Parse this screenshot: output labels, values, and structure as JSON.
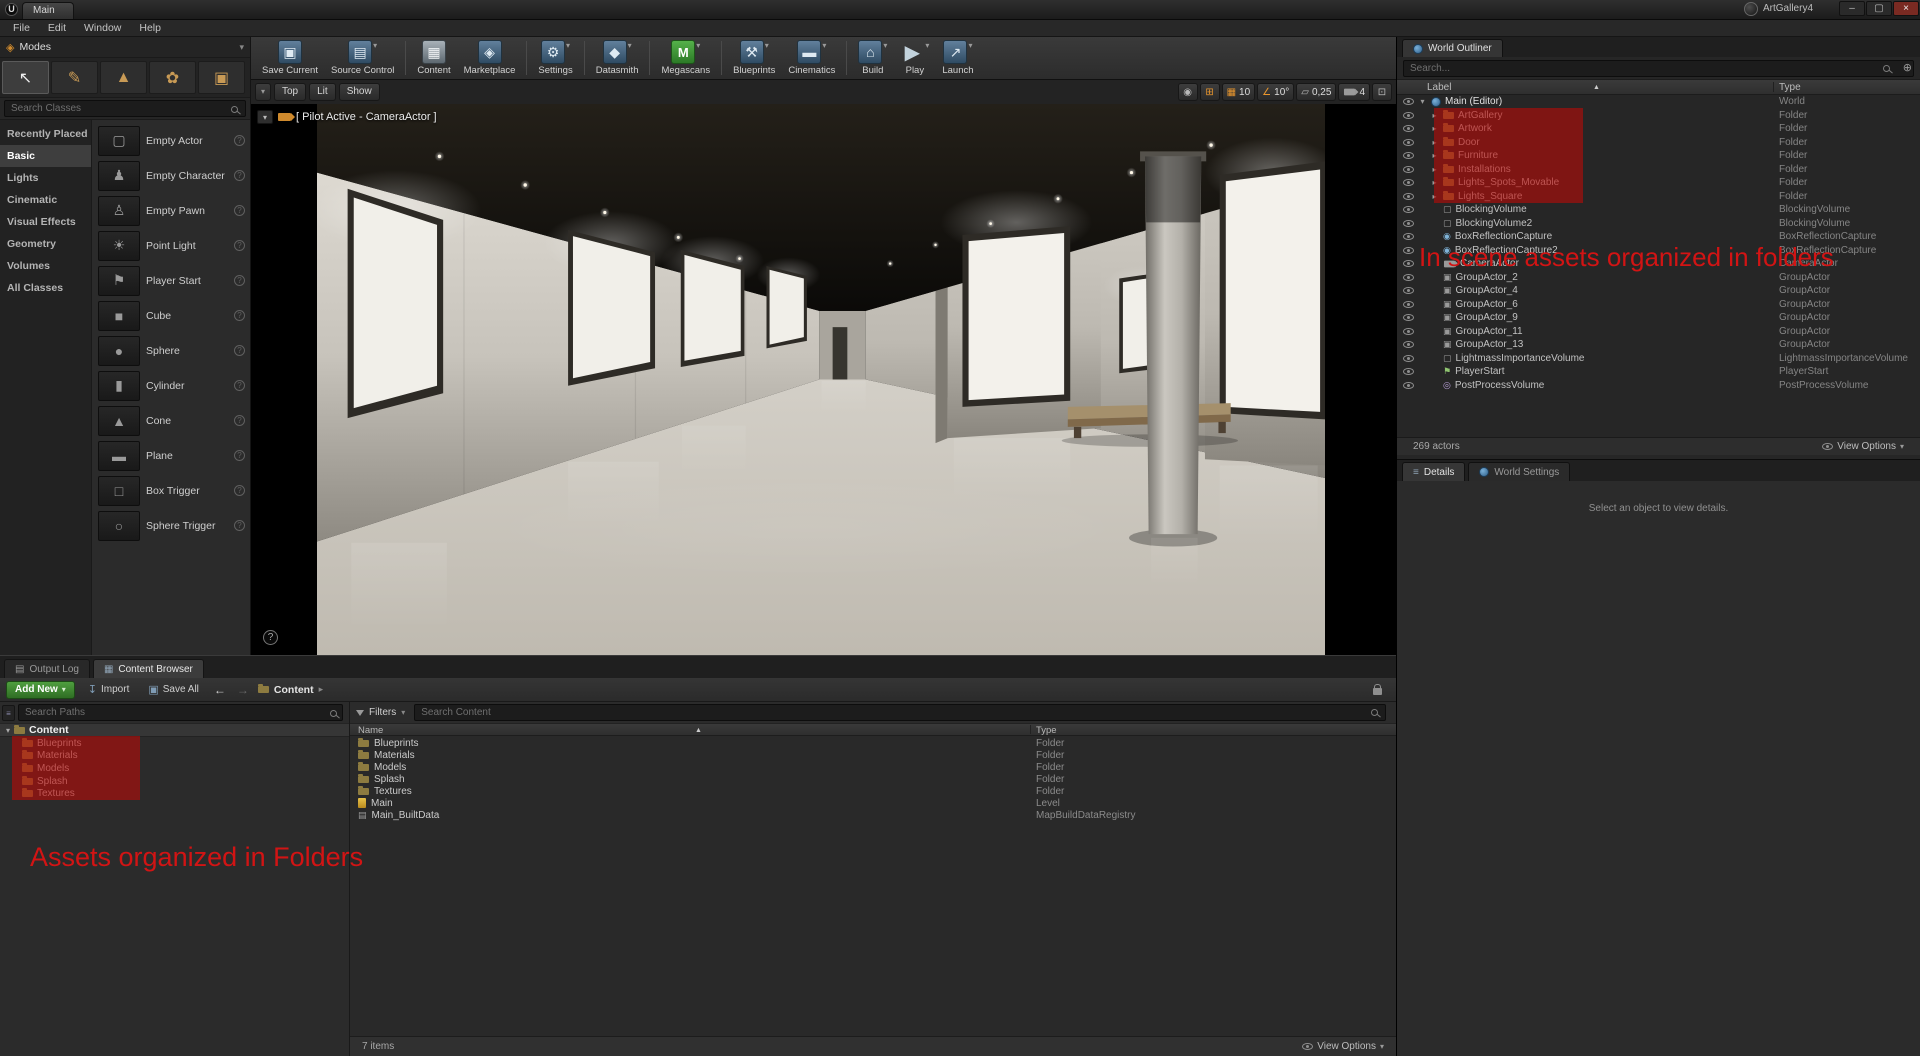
{
  "titlebar": {
    "logo": "U",
    "tab": "Main",
    "project": "ArtGallery4",
    "minimize": "–",
    "maximize": "▢",
    "close": "×"
  },
  "menubar": {
    "items": [
      "File",
      "Edit",
      "Window",
      "Help"
    ]
  },
  "icons": {
    "chevron_down": "▾",
    "chevron_right": "▸",
    "sort_asc": "▲",
    "back_arrow": "←",
    "forward_arrow": "→",
    "controller": "◉",
    "surface_snap": "⊞",
    "grid": "▦",
    "angle": "∠",
    "scale": "▱",
    "maximize": "⊡",
    "plus": "⊕",
    "hamburger": "≡",
    "volume": "▢",
    "capture": "◉",
    "group": "▣",
    "playerstart": "⚑",
    "ppvolume": "◎",
    "data": "▤",
    "output_log": "▤",
    "content_drawer": "▦",
    "import": "↧",
    "save": "▣",
    "details": "≡"
  },
  "modes_panel": {
    "title": "Modes",
    "tools": [
      {
        "name": "place-mode",
        "glyph": "↖",
        "active": true
      },
      {
        "name": "paint-mode",
        "glyph": "✎",
        "active": false
      },
      {
        "name": "landscape-mode",
        "glyph": "▲",
        "active": false
      },
      {
        "name": "foliage-mode",
        "glyph": "✿",
        "active": false
      },
      {
        "name": "geometry-mode",
        "glyph": "▣",
        "active": false
      }
    ],
    "search_placeholder": "Search Classes",
    "categories": [
      {
        "label": "Recently Placed",
        "selected": false
      },
      {
        "label": "Basic",
        "selected": true
      },
      {
        "label": "Lights",
        "selected": false
      },
      {
        "label": "Cinematic",
        "selected": false
      },
      {
        "label": "Visual Effects",
        "selected": false
      },
      {
        "label": "Geometry",
        "selected": false
      },
      {
        "label": "Volumes",
        "selected": false
      },
      {
        "label": "All Classes",
        "selected": false
      }
    ],
    "items": [
      {
        "label": "Empty Actor",
        "glyph": "▢"
      },
      {
        "label": "Empty Character",
        "glyph": "♟"
      },
      {
        "label": "Empty Pawn",
        "glyph": "♙"
      },
      {
        "label": "Point Light",
        "glyph": "☀"
      },
      {
        "label": "Player Start",
        "glyph": "⚑"
      },
      {
        "label": "Cube",
        "glyph": "■"
      },
      {
        "label": "Sphere",
        "glyph": "●"
      },
      {
        "label": "Cylinder",
        "glyph": "▮"
      },
      {
        "label": "Cone",
        "glyph": "▲"
      },
      {
        "label": "Plane",
        "glyph": "▬"
      },
      {
        "label": "Box Trigger",
        "glyph": "□"
      },
      {
        "label": "Sphere Trigger",
        "glyph": "○"
      }
    ]
  },
  "main_toolbar": {
    "buttons": [
      {
        "label": "Save Current",
        "glyph": "▣",
        "style": "blue",
        "dropdown": false
      },
      {
        "label": "Source Control",
        "glyph": "▤",
        "style": "blue",
        "dropdown": true
      },
      {
        "separator": true
      },
      {
        "label": "Content",
        "glyph": "▦",
        "style": "steel",
        "dropdown": false
      },
      {
        "label": "Marketplace",
        "glyph": "◈",
        "style": "blue",
        "dropdown": false
      },
      {
        "separator": true
      },
      {
        "label": "Settings",
        "glyph": "⚙",
        "style": "blue",
        "dropdown": true
      },
      {
        "separator": true
      },
      {
        "label": "Datasmith",
        "glyph": "◆",
        "style": "blue",
        "dropdown": true
      },
      {
        "separator": true
      },
      {
        "label": "Megascans",
        "glyph": "M",
        "style": "green",
        "dropdown": true
      },
      {
        "separator": true
      },
      {
        "label": "Blueprints",
        "glyph": "⚒",
        "style": "blue",
        "dropdown": true
      },
      {
        "label": "Cinematics",
        "glyph": "▬",
        "style": "blue",
        "dropdown": true
      },
      {
        "separator": true
      },
      {
        "label": "Build",
        "glyph": "⌂",
        "style": "blue",
        "dropdown": true
      },
      {
        "label": "Play",
        "glyph": "▶",
        "style": "play",
        "dropdown": true
      },
      {
        "label": "Launch",
        "glyph": "↗",
        "style": "blue",
        "dropdown": true
      }
    ]
  },
  "viewport": {
    "pilot_label": "[ Pilot Active - CameraActor ]",
    "view_buttons": [
      "Top",
      "Lit",
      "Show"
    ],
    "snap": {
      "grid": "10",
      "angle": "10°",
      "scale": "0,25",
      "camera_speed": "4"
    },
    "help": "?"
  },
  "outliner": {
    "tab": "World Outliner",
    "search_placeholder": "Search...",
    "col_label": "Label",
    "col_type": "Type",
    "rows": [
      {
        "label": "Main (Editor)",
        "type": "World",
        "depth": 0,
        "icon": "world",
        "exp": "open"
      },
      {
        "label": "ArtGallery",
        "type": "Folder",
        "depth": 1,
        "icon": "folder",
        "exp": "closed",
        "hl": true
      },
      {
        "label": "Artwork",
        "type": "Folder",
        "depth": 1,
        "icon": "folder",
        "exp": "closed",
        "hl": true
      },
      {
        "label": "Door",
        "type": "Folder",
        "depth": 1,
        "icon": "folder",
        "exp": "closed",
        "hl": true
      },
      {
        "label": "Furniture",
        "type": "Folder",
        "depth": 1,
        "icon": "folder",
        "exp": "closed",
        "hl": true
      },
      {
        "label": "Installations",
        "type": "Folder",
        "depth": 1,
        "icon": "folder",
        "exp": "closed",
        "hl": true
      },
      {
        "label": "Lights_Spots_Movable",
        "type": "Folder",
        "depth": 1,
        "icon": "folder",
        "exp": "closed",
        "hl": true
      },
      {
        "label": "Lights_Square",
        "type": "Folder",
        "depth": 1,
        "icon": "folder",
        "exp": "closed",
        "hl": true
      },
      {
        "label": "BlockingVolume",
        "type": "BlockingVolume",
        "depth": 1,
        "icon": "volume"
      },
      {
        "label": "BlockingVolume2",
        "type": "BlockingVolume",
        "depth": 1,
        "icon": "volume"
      },
      {
        "label": "BoxReflectionCapture",
        "type": "BoxReflectionCapture",
        "depth": 1,
        "icon": "capture"
      },
      {
        "label": "BoxReflectionCapture2",
        "type": "BoxReflectionCapture",
        "depth": 1,
        "icon": "capture"
      },
      {
        "label": "CameraActor",
        "type": "CameraActor",
        "depth": 1,
        "icon": "camera"
      },
      {
        "label": "GroupActor_2",
        "type": "GroupActor",
        "depth": 1,
        "icon": "group"
      },
      {
        "label": "GroupActor_4",
        "type": "GroupActor",
        "depth": 1,
        "icon": "group"
      },
      {
        "label": "GroupActor_6",
        "type": "GroupActor",
        "depth": 1,
        "icon": "group"
      },
      {
        "label": "GroupActor_9",
        "type": "GroupActor",
        "depth": 1,
        "icon": "group"
      },
      {
        "label": "GroupActor_11",
        "type": "GroupActor",
        "depth": 1,
        "icon": "group"
      },
      {
        "label": "GroupActor_13",
        "type": "GroupActor",
        "depth": 1,
        "icon": "group"
      },
      {
        "label": "LightmassImportanceVolume",
        "type": "LightmassImportanceVolume",
        "depth": 1,
        "icon": "volume"
      },
      {
        "label": "PlayerStart",
        "type": "PlayerStart",
        "depth": 1,
        "icon": "playerstart"
      },
      {
        "label": "PostProcessVolume",
        "type": "PostProcessVolume",
        "depth": 1,
        "icon": "ppvolume"
      }
    ],
    "footer": "269 actors",
    "view_options": "View Options"
  },
  "details": {
    "tab_details": "Details",
    "tab_world_settings": "World Settings",
    "message": "Select an object to view details."
  },
  "content_browser": {
    "tab_output_log": "Output Log",
    "tab_content_browser": "Content Browser",
    "add_new": "Add New",
    "import": "Import",
    "save_all": "Save All",
    "breadcrumb": "Content",
    "search_paths_placeholder": "Search Paths",
    "filters": "Filters",
    "search_content_placeholder": "Search Content",
    "tree_root": "Content",
    "tree_items": [
      "Blueprints",
      "Materials",
      "Models",
      "Splash",
      "Textures"
    ],
    "col_name": "Name",
    "col_type": "Type",
    "rows": [
      {
        "name": "Blueprints",
        "type": "Folder",
        "icon": "folder"
      },
      {
        "name": "Materials",
        "type": "Folder",
        "icon": "folder"
      },
      {
        "name": "Models",
        "type": "Folder",
        "icon": "folder"
      },
      {
        "name": "Splash",
        "type": "Folder",
        "icon": "folder"
      },
      {
        "name": "Textures",
        "type": "Folder",
        "icon": "folder"
      },
      {
        "name": "Main",
        "type": "Level",
        "icon": "level"
      },
      {
        "name": "Main_BuiltData",
        "type": "MapBuildDataRegistry",
        "icon": "data"
      }
    ],
    "footer": "7 items",
    "view_options": "View Options"
  },
  "annotations": {
    "outliner_note": "In scene assets organized in folders",
    "content_note": "Assets organized in Folders",
    "highlight_color": "#ba0a06",
    "text_color": "#d21414"
  }
}
